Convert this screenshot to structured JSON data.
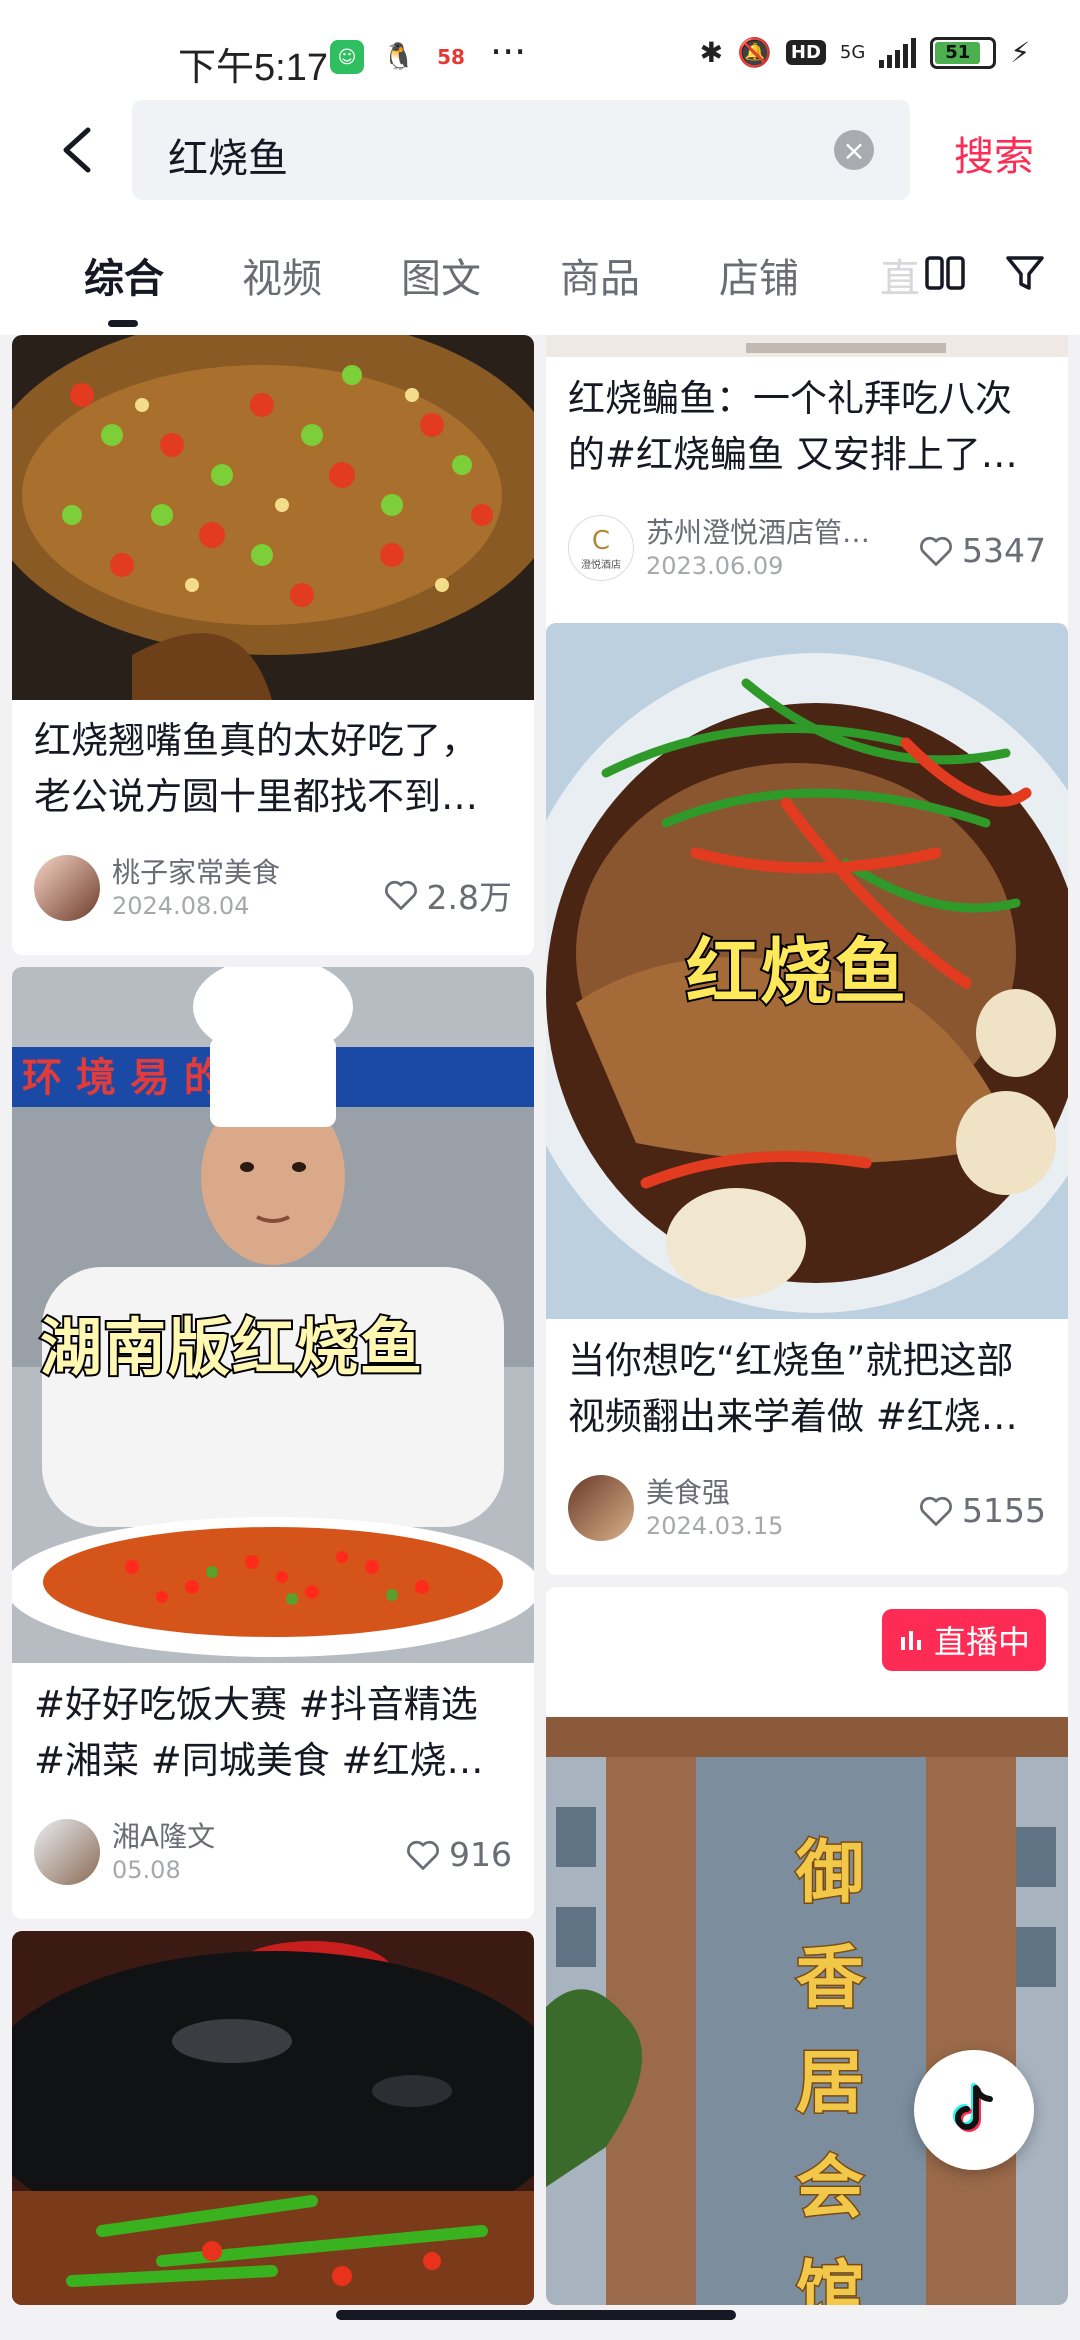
{
  "status": {
    "time": "下午5:17",
    "network": "5G",
    "battery": "51"
  },
  "search": {
    "query": "红烧鱼",
    "button": "搜索"
  },
  "tabs": [
    {
      "label": "综合"
    },
    {
      "label": "视频"
    },
    {
      "label": "图文"
    },
    {
      "label": "商品"
    },
    {
      "label": "店铺"
    }
  ],
  "tab_partial": "直",
  "cards": {
    "c1": {
      "title": "红烧翘嘴鱼真的太好吃了，老公说方圆十里都找不到…",
      "author": "桃子家常美食",
      "date": "2024.08.04",
      "likes": "2.8万"
    },
    "c2": {
      "overlay": "湖南版红烧鱼",
      "bg_text": "环 境     易 的  是",
      "title": "#好好吃饭大赛 #抖音精选 #湘菜 #同城美食 #红烧…",
      "author": "湘A隆文",
      "date": "05.08",
      "likes": "916"
    },
    "r1": {
      "title": "红烧鳊鱼：一个礼拜吃八次的#红烧鳊鱼 又安排上了…",
      "author": "苏州澄悦酒店管…",
      "date": "2023.06.09",
      "likes": "5347",
      "avatar_text": "澄悦酒店"
    },
    "r2": {
      "overlay": "红烧鱼",
      "title": "当你想吃“红烧鱼”就把这部视频翻出来学着做 #红烧…",
      "author": "美食强",
      "date": "2024.03.15",
      "likes": "5155"
    },
    "r3": {
      "live": "直播中",
      "sign": [
        "御",
        "香",
        "居",
        "会",
        "馆"
      ]
    }
  },
  "colors": {
    "accent": "#fe2c55",
    "text": "#161823",
    "secondary": "#6b6d75"
  },
  "icons": [
    "back-arrow-icon",
    "clear-icon",
    "double-column-icon",
    "filter-icon",
    "heart-icon",
    "tiktok-icon"
  ]
}
